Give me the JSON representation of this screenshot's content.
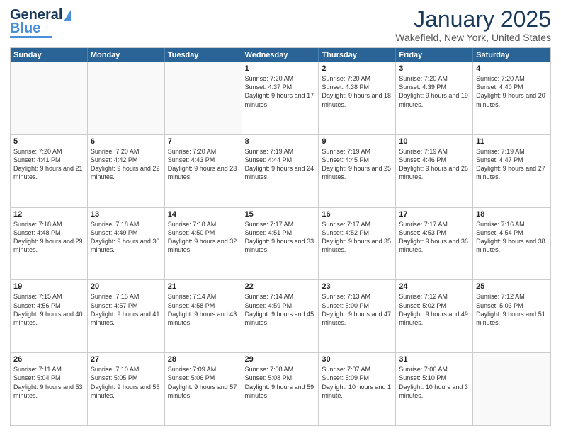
{
  "header": {
    "logo_general": "General",
    "logo_blue": "Blue",
    "month_title": "January 2025",
    "location": "Wakefield, New York, United States"
  },
  "weekdays": [
    "Sunday",
    "Monday",
    "Tuesday",
    "Wednesday",
    "Thursday",
    "Friday",
    "Saturday"
  ],
  "rows": [
    [
      {
        "day": "",
        "text": ""
      },
      {
        "day": "",
        "text": ""
      },
      {
        "day": "",
        "text": ""
      },
      {
        "day": "1",
        "text": "Sunrise: 7:20 AM\nSunset: 4:37 PM\nDaylight: 9 hours\nand 17 minutes."
      },
      {
        "day": "2",
        "text": "Sunrise: 7:20 AM\nSunset: 4:38 PM\nDaylight: 9 hours\nand 18 minutes."
      },
      {
        "day": "3",
        "text": "Sunrise: 7:20 AM\nSunset: 4:39 PM\nDaylight: 9 hours\nand 19 minutes."
      },
      {
        "day": "4",
        "text": "Sunrise: 7:20 AM\nSunset: 4:40 PM\nDaylight: 9 hours\nand 20 minutes."
      }
    ],
    [
      {
        "day": "5",
        "text": "Sunrise: 7:20 AM\nSunset: 4:41 PM\nDaylight: 9 hours\nand 21 minutes."
      },
      {
        "day": "6",
        "text": "Sunrise: 7:20 AM\nSunset: 4:42 PM\nDaylight: 9 hours\nand 22 minutes."
      },
      {
        "day": "7",
        "text": "Sunrise: 7:20 AM\nSunset: 4:43 PM\nDaylight: 9 hours\nand 23 minutes."
      },
      {
        "day": "8",
        "text": "Sunrise: 7:19 AM\nSunset: 4:44 PM\nDaylight: 9 hours\nand 24 minutes."
      },
      {
        "day": "9",
        "text": "Sunrise: 7:19 AM\nSunset: 4:45 PM\nDaylight: 9 hours\nand 25 minutes."
      },
      {
        "day": "10",
        "text": "Sunrise: 7:19 AM\nSunset: 4:46 PM\nDaylight: 9 hours\nand 26 minutes."
      },
      {
        "day": "11",
        "text": "Sunrise: 7:19 AM\nSunset: 4:47 PM\nDaylight: 9 hours\nand 27 minutes."
      }
    ],
    [
      {
        "day": "12",
        "text": "Sunrise: 7:18 AM\nSunset: 4:48 PM\nDaylight: 9 hours\nand 29 minutes."
      },
      {
        "day": "13",
        "text": "Sunrise: 7:18 AM\nSunset: 4:49 PM\nDaylight: 9 hours\nand 30 minutes."
      },
      {
        "day": "14",
        "text": "Sunrise: 7:18 AM\nSunset: 4:50 PM\nDaylight: 9 hours\nand 32 minutes."
      },
      {
        "day": "15",
        "text": "Sunrise: 7:17 AM\nSunset: 4:51 PM\nDaylight: 9 hours\nand 33 minutes."
      },
      {
        "day": "16",
        "text": "Sunrise: 7:17 AM\nSunset: 4:52 PM\nDaylight: 9 hours\nand 35 minutes."
      },
      {
        "day": "17",
        "text": "Sunrise: 7:17 AM\nSunset: 4:53 PM\nDaylight: 9 hours\nand 36 minutes."
      },
      {
        "day": "18",
        "text": "Sunrise: 7:16 AM\nSunset: 4:54 PM\nDaylight: 9 hours\nand 38 minutes."
      }
    ],
    [
      {
        "day": "19",
        "text": "Sunrise: 7:15 AM\nSunset: 4:56 PM\nDaylight: 9 hours\nand 40 minutes."
      },
      {
        "day": "20",
        "text": "Sunrise: 7:15 AM\nSunset: 4:57 PM\nDaylight: 9 hours\nand 41 minutes."
      },
      {
        "day": "21",
        "text": "Sunrise: 7:14 AM\nSunset: 4:58 PM\nDaylight: 9 hours\nand 43 minutes."
      },
      {
        "day": "22",
        "text": "Sunrise: 7:14 AM\nSunset: 4:59 PM\nDaylight: 9 hours\nand 45 minutes."
      },
      {
        "day": "23",
        "text": "Sunrise: 7:13 AM\nSunset: 5:00 PM\nDaylight: 9 hours\nand 47 minutes."
      },
      {
        "day": "24",
        "text": "Sunrise: 7:12 AM\nSunset: 5:02 PM\nDaylight: 9 hours\nand 49 minutes."
      },
      {
        "day": "25",
        "text": "Sunrise: 7:12 AM\nSunset: 5:03 PM\nDaylight: 9 hours\nand 51 minutes."
      }
    ],
    [
      {
        "day": "26",
        "text": "Sunrise: 7:11 AM\nSunset: 5:04 PM\nDaylight: 9 hours\nand 53 minutes."
      },
      {
        "day": "27",
        "text": "Sunrise: 7:10 AM\nSunset: 5:05 PM\nDaylight: 9 hours\nand 55 minutes."
      },
      {
        "day": "28",
        "text": "Sunrise: 7:09 AM\nSunset: 5:06 PM\nDaylight: 9 hours\nand 57 minutes."
      },
      {
        "day": "29",
        "text": "Sunrise: 7:08 AM\nSunset: 5:08 PM\nDaylight: 9 hours\nand 59 minutes."
      },
      {
        "day": "30",
        "text": "Sunrise: 7:07 AM\nSunset: 5:09 PM\nDaylight: 10 hours\nand 1 minute."
      },
      {
        "day": "31",
        "text": "Sunrise: 7:06 AM\nSunset: 5:10 PM\nDaylight: 10 hours\nand 3 minutes."
      },
      {
        "day": "",
        "text": ""
      }
    ]
  ]
}
